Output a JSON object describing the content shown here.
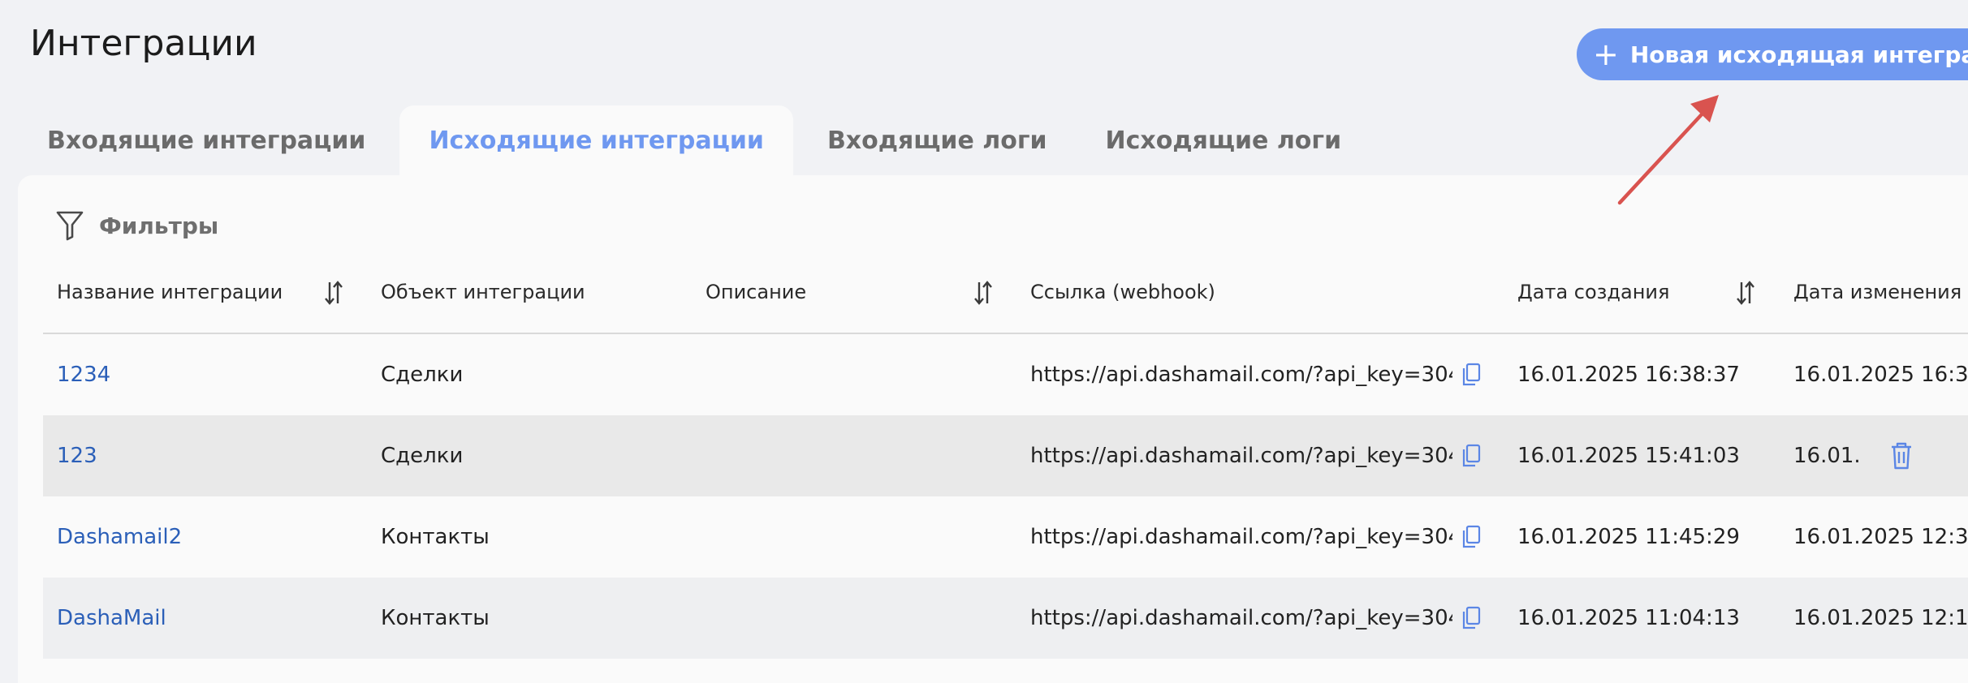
{
  "page": {
    "title": "Интеграции"
  },
  "new_button": {
    "plus": "+",
    "label": "Новая исходящая интеграция"
  },
  "tabs": [
    {
      "label": "Входящие интеграции",
      "active": false
    },
    {
      "label": "Исходящие интеграции",
      "active": true
    },
    {
      "label": "Входящие логи",
      "active": false
    },
    {
      "label": "Исходящие логи",
      "active": false
    }
  ],
  "filters": {
    "label": "Фильтры",
    "icon": "filter-icon"
  },
  "table": {
    "columns": [
      {
        "label": "Название интеграции",
        "sortable": true
      },
      {
        "label": "Объект интеграции",
        "sortable": false
      },
      {
        "label": "Описание",
        "sortable": true
      },
      {
        "label": "Ссылка (webhook)",
        "sortable": false
      },
      {
        "label": "Дата создания",
        "sortable": true
      },
      {
        "label": "Дата изменения",
        "sortable": false
      }
    ],
    "rows": [
      {
        "name": "1234",
        "object": "Сделки",
        "description": "",
        "webhook": "https://api.dashamail.com/?api_key=304...",
        "created": "16.01.2025 16:38:37",
        "modified": "16.01.2025 16:3"
      },
      {
        "name": "123",
        "object": "Сделки",
        "description": "",
        "webhook": "https://api.dashamail.com/?api_key=304...",
        "created": "16.01.2025 15:41:03",
        "modified": "16.01."
      },
      {
        "name": "Dashamail2",
        "object": "Контакты",
        "description": "",
        "webhook": "https://api.dashamail.com/?api_key=304...",
        "created": "16.01.2025 11:45:29",
        "modified": "16.01.2025 12:3"
      },
      {
        "name": "DashaMail",
        "object": "Контакты",
        "description": "",
        "webhook": "https://api.dashamail.com/?api_key=304...",
        "created": "16.01.2025 11:04:13",
        "modified": "16.01.2025 12:1"
      }
    ]
  },
  "colors": {
    "accent": "#6f98f0",
    "link": "#2b5fb8",
    "annotation_arrow": "#d9534f"
  }
}
